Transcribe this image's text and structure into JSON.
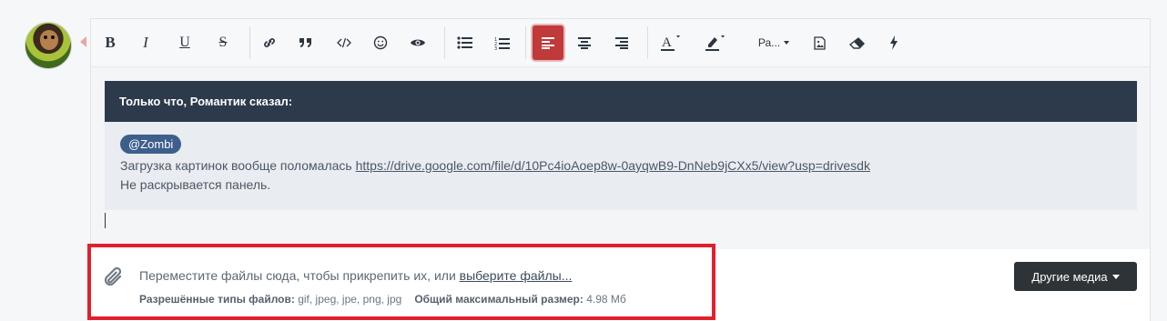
{
  "toolbar": {
    "paragraph_label": "Ра..."
  },
  "quote": {
    "header": "Только что, Романтик сказал:",
    "mention": "@Zombi",
    "line1_text": "Загрузка картинок вообще поломалась ",
    "line1_link": "https://drive.google.com/file/d/10Pc4ioAoep8w-0ayqwB9-DnNeb9jCXx5/view?usp=drivesdk",
    "line2_text": "Не раскрывается панель."
  },
  "attachments": {
    "drop_text": "Переместите файлы сюда, чтобы прикрепить их, или ",
    "choose_link": "выберите файлы...",
    "types_label": "Разрешённые типы файлов:",
    "types_value": "gif, jpeg, jpe, png, jpg",
    "size_label": "Общий максимальный размер:",
    "size_value": "4.98 Мб",
    "other_media_button": "Другие медиа"
  },
  "colors": {
    "active_button": "#c0393b",
    "quote_header_bg": "#2c3a4b",
    "mention_bg": "#3d5f8c",
    "highlight_border": "#e0212d",
    "media_button_bg": "#2e3338"
  }
}
